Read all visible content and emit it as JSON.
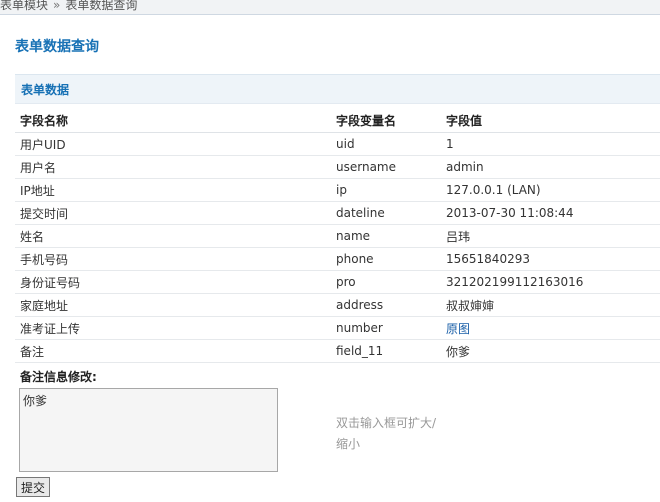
{
  "breadcrumb": {
    "parent": "表单模块",
    "separator": "»",
    "current": "表单数据查询"
  },
  "page": {
    "title": "表单数据查询"
  },
  "section": {
    "title": "表单数据"
  },
  "table": {
    "headers": [
      "字段名称",
      "字段变量名",
      "字段值"
    ],
    "rows": [
      {
        "name": "用户UID",
        "var": "uid",
        "value": "1"
      },
      {
        "name": "用户名",
        "var": "username",
        "value": "admin"
      },
      {
        "name": "IP地址",
        "var": "ip",
        "value": "127.0.0.1 (LAN)"
      },
      {
        "name": "提交时间",
        "var": "dateline",
        "value": "2013-07-30 11:08:44"
      },
      {
        "name": "姓名",
        "var": "name",
        "value": "吕玮"
      },
      {
        "name": "手机号码",
        "var": "phone",
        "value": "15651840293"
      },
      {
        "name": "身份证号码",
        "var": "pro",
        "value": "321202199112163016"
      },
      {
        "name": "家庭地址",
        "var": "address",
        "value": "叔叔婶婶"
      },
      {
        "name": "准考证上传",
        "var": "number",
        "value": "原图"
      },
      {
        "name": "备注",
        "var": "field_11",
        "value": "你爹"
      }
    ]
  },
  "edit": {
    "label": "备注信息修改:",
    "value": "你爹",
    "hint": "双击输入框可扩大/缩小"
  },
  "submit": {
    "label": "提交"
  },
  "colors": {
    "title": "#1771b5",
    "link": "#1a5fa8",
    "section_bg": "#eef4f9"
  }
}
